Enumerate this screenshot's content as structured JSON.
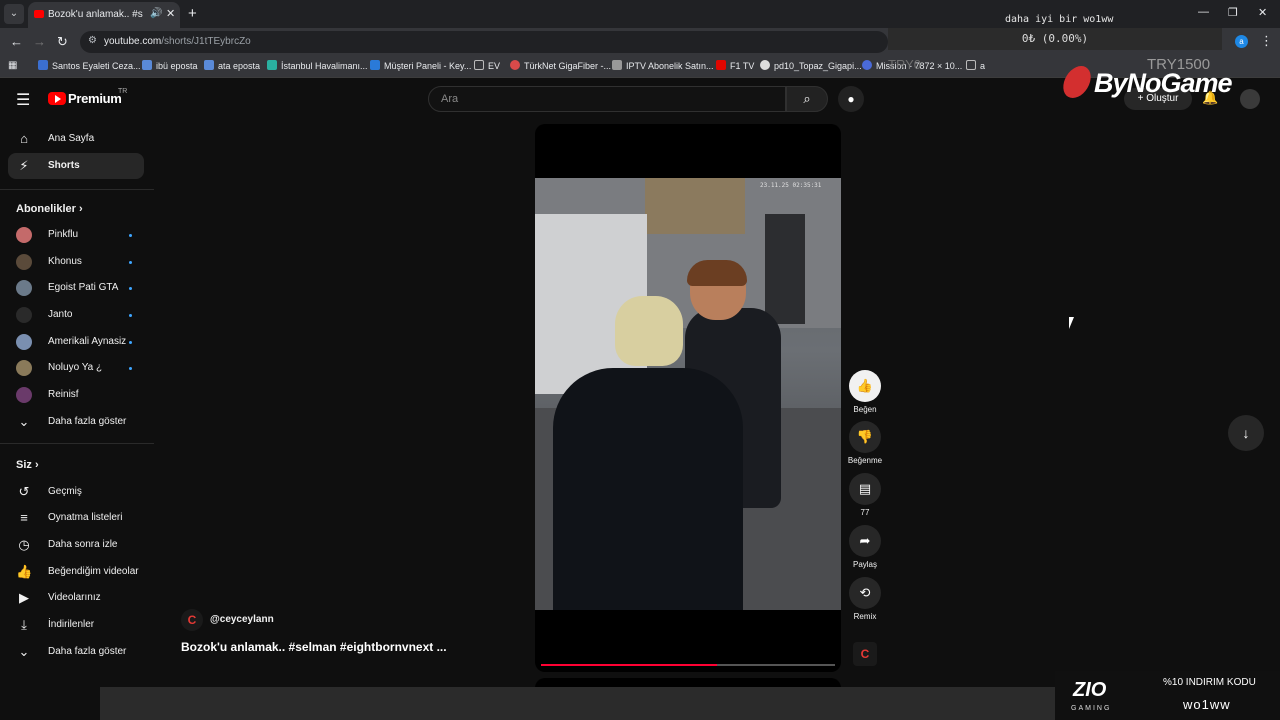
{
  "browser": {
    "tab_title": "Bozok'u anlamak.. #selman",
    "url_host": "youtube.com",
    "url_path": "/shorts/J1tTEybrcZo",
    "profile_letter": "a",
    "bookmarks": [
      "Santos Eyaleti Ceza...",
      "ibü eposta",
      "ata eposta",
      "İstanbul Havalimanı...",
      "Müşteri Paneli - Key...",
      "EV",
      "TürkNet GigaFiber -...",
      "IPTV Abonelik Satın...",
      "F1 TV",
      "pd10_Topaz_Gigapi...",
      "Mission - 7872 × 10...",
      "a"
    ]
  },
  "stream_overlay": {
    "top_text": "daha iyi bir wo1ww",
    "progress_text": "0₺ (0.00%)",
    "ghost_text": "TRY0",
    "price": "TRY1500",
    "brand": "ByNoGame",
    "sponsor_name": "ZIO",
    "sponsor_sub": "GAMING",
    "promo_text": "%10 INDIRIM KODU",
    "promo_code": "wo1ww"
  },
  "header": {
    "logo_text": "Premium",
    "logo_region": "TR",
    "search_placeholder": "Ara",
    "create_label": "Oluştur"
  },
  "sidebar": {
    "main": [
      {
        "label": "Ana Sayfa",
        "icon": "home-icon"
      },
      {
        "label": "Shorts",
        "icon": "shorts-icon"
      }
    ],
    "subs_heading": "Abonelikler",
    "subscriptions": [
      {
        "label": "Pinkflu",
        "color": "#c46a6a"
      },
      {
        "label": "Khonus",
        "color": "#5a4a3a"
      },
      {
        "label": "Egoist Pati GTA",
        "color": "#6b7a8a"
      },
      {
        "label": "Janto",
        "color": "#2a2a2a"
      },
      {
        "label": "Amerikali Aynasiz",
        "color": "#7a8fb0"
      },
      {
        "label": "Noluyo Ya ¿",
        "color": "#8a7a5a"
      },
      {
        "label": "Reinisf",
        "color": "#6a3a6a"
      }
    ],
    "show_more_1": "Daha fazla göster",
    "you_heading": "Siz",
    "you_items": [
      {
        "label": "Geçmiş",
        "icon": "history-icon"
      },
      {
        "label": "Oynatma listeleri",
        "icon": "playlist-icon"
      },
      {
        "label": "Daha sonra izle",
        "icon": "clock-icon"
      },
      {
        "label": "Beğendiğim videolar",
        "icon": "like-icon"
      },
      {
        "label": "Videolarınız",
        "icon": "video-icon"
      },
      {
        "label": "İndirilenler",
        "icon": "download-icon"
      }
    ],
    "show_more_2": "Daha fazla göster"
  },
  "video": {
    "timestamp": "23.11.25 02:35:31",
    "channel": "@ceyceylann",
    "channel_initial": "C",
    "title": "Bozok'u anlamak.. #selman #eightbornvnext ...",
    "progress": 0.6
  },
  "actions": {
    "like": "Beğen",
    "dislike": "Beğenme",
    "comments": "77",
    "share": "Paylaş",
    "remix": "Remix"
  },
  "colors": {
    "accent": "#ff0033",
    "brand_red": "#ff0000",
    "badge_blue": "#3ea6ff"
  }
}
